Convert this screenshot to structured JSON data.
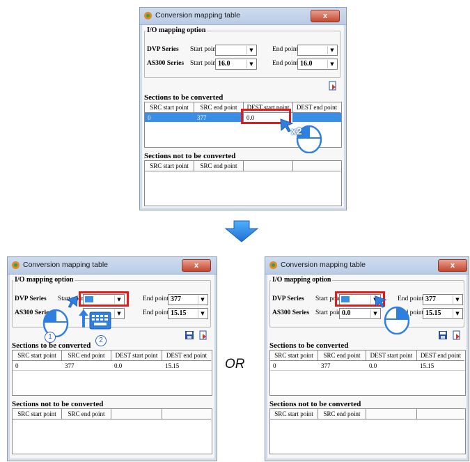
{
  "dialog": {
    "title": "Conversion mapping table",
    "close_label": "x",
    "io_group_title": "I/O mapping option",
    "dvp_label": "DVP Series",
    "as300_label": "AS300 Series",
    "start_point_label": "Start point",
    "end_point_label": "End point",
    "sections_converted_title": "Sections to be converted",
    "sections_not_converted_title": "Sections not to be converted",
    "columns": [
      "SRC start point",
      "SRC end point",
      "DEST start point",
      "DEST end point"
    ]
  },
  "panel_top": {
    "dvp_start": "",
    "dvp_end": "",
    "as300_start": "16.0",
    "as300_end": "16.0",
    "row": {
      "src_start": "0",
      "src_end": "377",
      "dest_start": "0.0",
      "dest_end": ""
    }
  },
  "panel_left": {
    "dvp_start": "",
    "dvp_end": "377",
    "as300_start": "",
    "as300_end": "15.15",
    "row": {
      "src_start": "0",
      "src_end": "377",
      "dest_start": "0.0",
      "dest_end": "15.15"
    }
  },
  "panel_right": {
    "dvp_start": "",
    "dvp_end": "377",
    "as300_start": "0.0",
    "as300_end": "15.15",
    "row": {
      "src_start": "0",
      "src_end": "377",
      "dest_start": "0.0",
      "dest_end": "15.15"
    }
  },
  "annotations": {
    "double_click": "x2",
    "step1": "1",
    "step2": "2",
    "or_text": "OR"
  },
  "colors": {
    "highlight_red": "#e21b1b",
    "selection_blue": "#3a8ee6",
    "arrow_blue": "#2f7fe0"
  }
}
